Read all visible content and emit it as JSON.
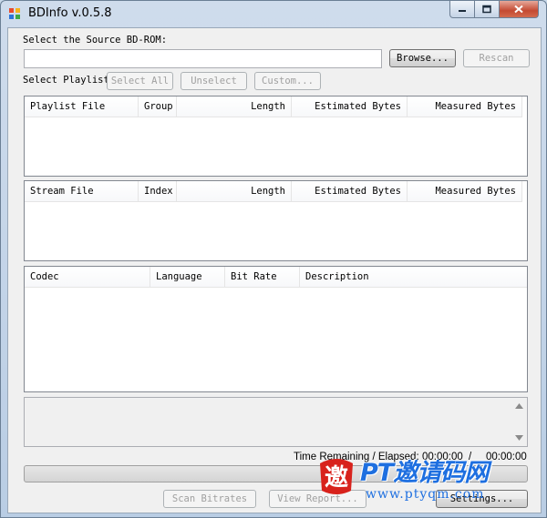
{
  "window": {
    "title": "BDInfo v.0.5.8",
    "colors": {
      "close_button": "#c44a32",
      "client_bg": "#f0f0f0",
      "frame": "#c9d9ea"
    }
  },
  "source": {
    "label": "Select the Source BD-ROM:",
    "path_value": "",
    "browse_label": "Browse...",
    "rescan_label": "Rescan"
  },
  "playlist": {
    "label": "Select Playlist",
    "select_all_label": "Select All",
    "unselect_label": "Unselect",
    "custom_label": "Custom...",
    "columns": [
      "Playlist File",
      "Group",
      "Length",
      "Estimated Bytes",
      "Measured Bytes"
    ],
    "rows": []
  },
  "streams": {
    "columns": [
      "Stream File",
      "Index",
      "Length",
      "Estimated Bytes",
      "Measured Bytes"
    ],
    "rows": []
  },
  "codecs": {
    "columns": [
      "Codec",
      "Language",
      "Bit Rate",
      "Description"
    ],
    "rows": []
  },
  "report": {
    "text": ""
  },
  "status": {
    "time_label": "Time Remaining / Elapsed:",
    "remaining": "00:00:00",
    "separator": "/",
    "elapsed": "00:00:00",
    "progress": 0
  },
  "footer": {
    "scan_label": "Scan Bitrates",
    "view_report_label": "View Report...",
    "settings_label": "Settings..."
  },
  "watermark": {
    "glyph": "邀",
    "brand": "PT邀请码网",
    "url": "www.ptyqm.com",
    "color": "#1e6fe0"
  }
}
